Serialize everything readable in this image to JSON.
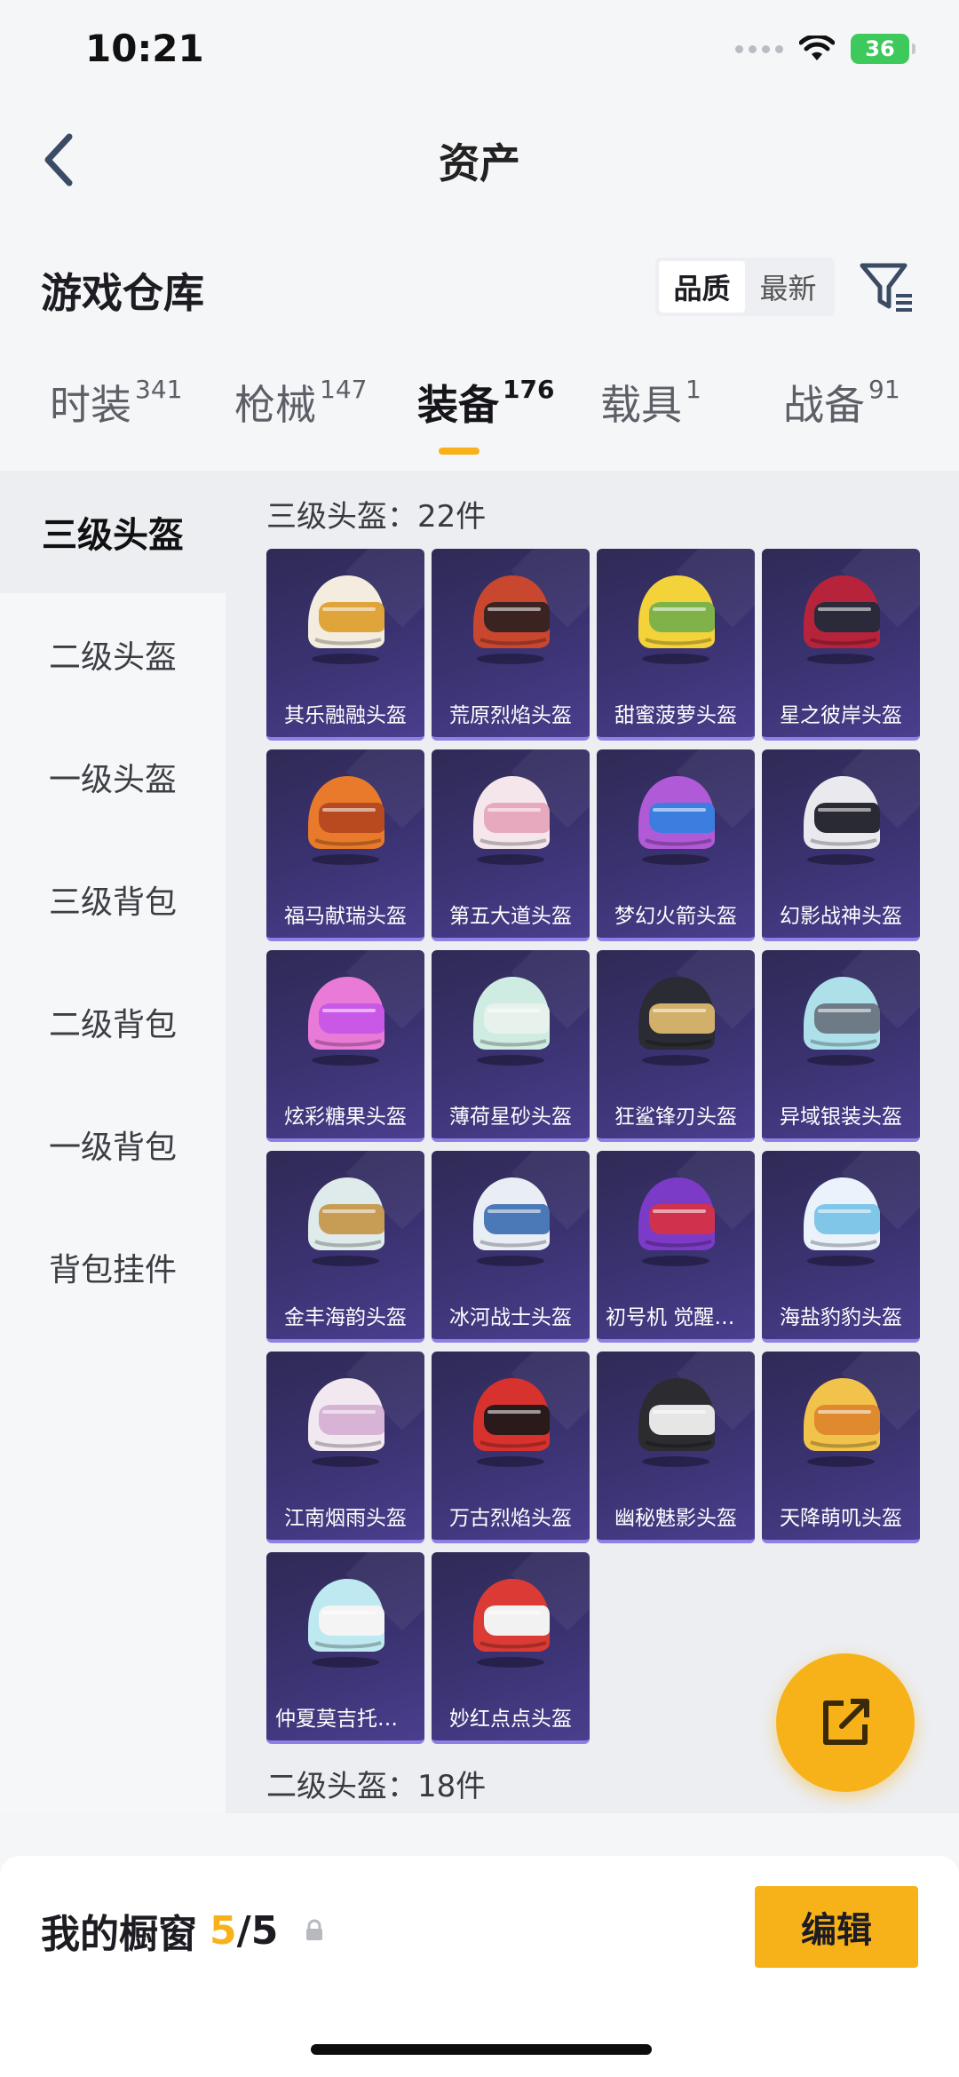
{
  "status_bar": {
    "time": "10:21",
    "battery": "36"
  },
  "nav": {
    "title": "资产"
  },
  "warehouse": {
    "title": "游戏仓库",
    "sort_options": [
      "品质",
      "最新"
    ],
    "active_sort": "品质"
  },
  "tabs": [
    {
      "label": "时装",
      "count": "341"
    },
    {
      "label": "枪械",
      "count": "147"
    },
    {
      "label": "装备",
      "count": "176",
      "active": true
    },
    {
      "label": "载具",
      "count": "1"
    },
    {
      "label": "战备",
      "count": "91"
    }
  ],
  "sidebar": {
    "items": [
      "三级头盔",
      "二级头盔",
      "一级头盔",
      "三级背包",
      "二级背包",
      "一级背包",
      "背包挂件"
    ],
    "active_index": 0
  },
  "groups": {
    "level3_label": "三级头盔：22件",
    "level2_label": "二级头盔：18件"
  },
  "items": [
    {
      "name": "其乐融融头盔",
      "colors": [
        "#f3ecdf",
        "#e0a53a"
      ]
    },
    {
      "name": "荒原烈焰头盔",
      "colors": [
        "#c9462f",
        "#3a2320"
      ]
    },
    {
      "name": "甜蜜菠萝头盔",
      "colors": [
        "#f4d33a",
        "#7fb34a"
      ]
    },
    {
      "name": "星之彼岸头盔",
      "colors": [
        "#b7233b",
        "#2a2a3a"
      ]
    },
    {
      "name": "福马献瑞头盔",
      "colors": [
        "#e97a2b",
        "#b74a1e"
      ]
    },
    {
      "name": "第五大道头盔",
      "colors": [
        "#f4e6ea",
        "#e7a9bd"
      ]
    },
    {
      "name": "梦幻火箭头盔",
      "colors": [
        "#b05ad8",
        "#3b7ee0"
      ]
    },
    {
      "name": "幻影战神头盔",
      "colors": [
        "#e9e9ee",
        "#2a2a34"
      ]
    },
    {
      "name": "炫彩糖果头盔",
      "colors": [
        "#ea7ad8",
        "#c958e6"
      ]
    },
    {
      "name": "薄荷星砂头盔",
      "colors": [
        "#cfece3",
        "#e7f2ec"
      ]
    },
    {
      "name": "狂鲨锋刃头盔",
      "colors": [
        "#2b2b33",
        "#d2b06a"
      ]
    },
    {
      "name": "异域银装头盔",
      "colors": [
        "#aee0ea",
        "#6e7b87"
      ]
    },
    {
      "name": "金丰海韵头盔",
      "colors": [
        "#dfeaea",
        "#c79c54"
      ]
    },
    {
      "name": "冰河战士头盔",
      "colors": [
        "#e9edf4",
        "#4b79b8"
      ]
    },
    {
      "name": "初号机 觉醒头盔",
      "colors": [
        "#7c3bc7",
        "#d0324d"
      ]
    },
    {
      "name": "海盐豹豹头盔",
      "colors": [
        "#eaf2fb",
        "#7fc6e8"
      ]
    },
    {
      "name": "江南烟雨头盔",
      "colors": [
        "#f2e8f0",
        "#d7b3d6"
      ]
    },
    {
      "name": "万古烈焰头盔",
      "colors": [
        "#d8322e",
        "#2b1a1a"
      ]
    },
    {
      "name": "幽秘魅影头盔",
      "colors": [
        "#2b2b30",
        "#e6e6e6"
      ]
    },
    {
      "name": "天降萌叽头盔",
      "colors": [
        "#f2c34a",
        "#e08a2f"
      ]
    },
    {
      "name": "仲夏莫吉托头盔",
      "colors": [
        "#bfe9f0",
        "#f4f4f4"
      ]
    },
    {
      "name": "妙红点点头盔",
      "colors": [
        "#dc3a34",
        "#f2f2f2"
      ]
    }
  ],
  "showcase": {
    "label": "我的橱窗",
    "count": "5",
    "total": "/5",
    "edit_label": "编辑"
  }
}
